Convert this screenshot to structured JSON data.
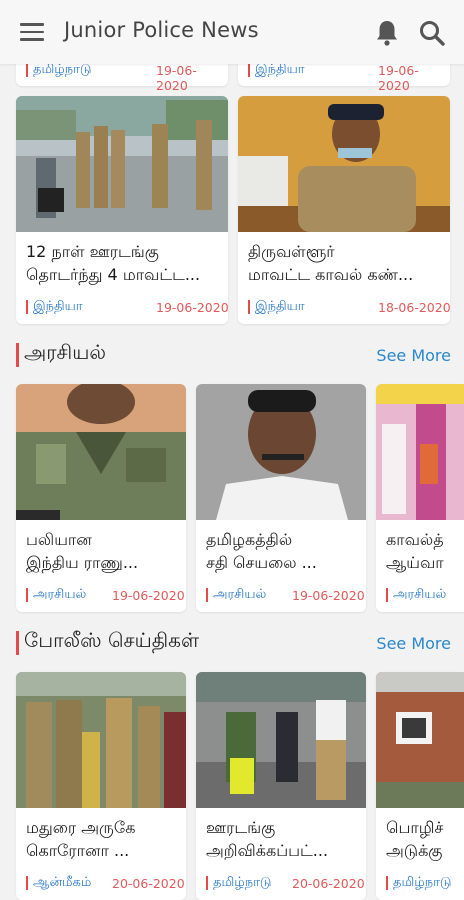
{
  "app_bar": {
    "title": "Junior Police News"
  },
  "top_partial": [
    {
      "category": "தமிழ்நாடு",
      "date": "19-06-2020"
    },
    {
      "category": "இந்தியா",
      "date": "19-06-2020"
    }
  ],
  "top_cards": [
    {
      "title": "12 நாள் ஊரடங்கு\nதொடர்ந்து 4 மாவட்ட...",
      "category": "இந்தியா",
      "date": "19-06-2020"
    },
    {
      "title": "திருவள்ளூர்\nமாவட்ட காவல் கண்...",
      "category": "இந்தியா",
      "date": "18-06-2020"
    }
  ],
  "sections": [
    {
      "title": "அரசியல்",
      "see_more": "See More",
      "cards": [
        {
          "title": "பலியான\nஇந்திய ராணு...",
          "category": "அரசியல்",
          "date": "19-06-2020"
        },
        {
          "title": "தமிழகத்தில்\nசதி செயலை ...",
          "category": "அரசியல்",
          "date": "19-06-2020"
        },
        {
          "title": "காவல்த்\nஆய்வா",
          "category": "அரசியல்",
          "date": ""
        }
      ]
    },
    {
      "title": "போலீஸ் செய்திகள்",
      "see_more": "See More",
      "cards": [
        {
          "title": "மதுரை அருகே\nகொரோனா ...",
          "category": "ஆன்மீகம்",
          "date": "20-06-2020"
        },
        {
          "title": "ஊரடங்கு\nஅறிவிக்கப்பட்...",
          "category": "தமிழ்நாடு",
          "date": "20-06-2020"
        },
        {
          "title": "பொழிச்\nஅடுக்கு",
          "category": "தமிழ்நாடு",
          "date": ""
        }
      ]
    }
  ],
  "colors": {
    "accent_red": "#e34a4a",
    "link_blue": "#2a88d0",
    "category_blue": "#2a78c8",
    "date_red": "#e05a5a"
  },
  "icons": [
    "menu-icon",
    "bell-icon",
    "search-icon"
  ]
}
